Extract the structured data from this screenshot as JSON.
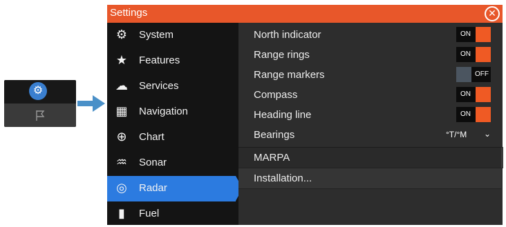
{
  "dialog": {
    "title": "Settings",
    "close_icon": "close-circle-icon",
    "accent_color": "#e8572a"
  },
  "sidebar": {
    "items": [
      {
        "label": "System",
        "icon": "gear-icon",
        "glyph": "⚙",
        "active": false
      },
      {
        "label": "Features",
        "icon": "star-icon",
        "glyph": "★",
        "active": false
      },
      {
        "label": "Services",
        "icon": "cloud-icon",
        "glyph": "☁",
        "active": false
      },
      {
        "label": "Navigation",
        "icon": "navigation-icon",
        "glyph": "▦",
        "active": false
      },
      {
        "label": "Chart",
        "icon": "globe-icon",
        "glyph": "⊕",
        "active": false
      },
      {
        "label": "Sonar",
        "icon": "sonar-icon",
        "glyph": "♒",
        "active": false
      },
      {
        "label": "Radar",
        "icon": "radar-icon",
        "glyph": "◎",
        "active": true
      },
      {
        "label": "Fuel",
        "icon": "fuel-icon",
        "glyph": "▮",
        "active": false
      }
    ],
    "active_color": "#2c7be0"
  },
  "settings": {
    "north_indicator": {
      "label": "North indicator",
      "state": "ON"
    },
    "range_rings": {
      "label": "Range rings",
      "state": "ON"
    },
    "range_markers": {
      "label": "Range markers",
      "state": "OFF"
    },
    "compass": {
      "label": "Compass",
      "state": "ON"
    },
    "heading_line": {
      "label": "Heading line",
      "state": "ON"
    },
    "bearings": {
      "label": "Bearings",
      "value": "°T/°M"
    },
    "marpa": {
      "label": "MARPA"
    },
    "installation": {
      "label": "Installation..."
    }
  },
  "thumbnail": {
    "icon": "gear-circle-icon",
    "flag_icon": "flag-icon"
  },
  "arrow": {
    "icon": "right-arrow-icon",
    "color": "#4a90c8"
  }
}
